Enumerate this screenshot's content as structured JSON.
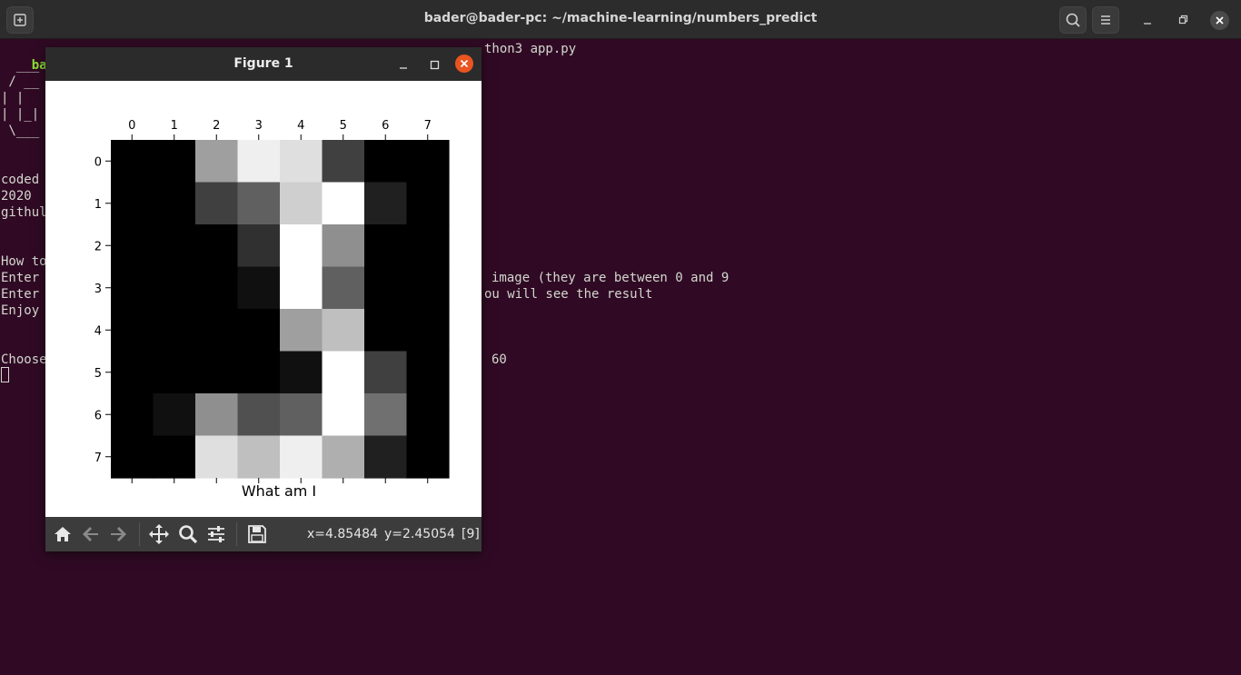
{
  "window": {
    "title": "bader@bader-pc: ~/machine-learning/numbers_predict"
  },
  "terminal": {
    "prompt_user": "bader@",
    "command_tail": "thon3 app.py",
    "lines": [
      "  ___",
      " / __",
      "| |",
      "| |_|",
      " \\___",
      "",
      "",
      "coded",
      "2020",
      "githul",
      "",
      "",
      "How to",
      "Enter",
      "Enter",
      "Enjoy",
      "",
      "",
      "Choose"
    ],
    "right_fragments": {
      "line13": "image (they are between 0 and 9",
      "line14": "ou will see the result",
      "line18": "60"
    }
  },
  "figure": {
    "title": "Figure 1",
    "xlabel": "What am I",
    "status": {
      "x": "x=4.85484",
      "y": "y=2.45054",
      "value": "[9]"
    }
  },
  "chart_data": {
    "type": "heatmap",
    "colormap": "gray",
    "xlabel": "What am I",
    "x_ticks": [
      0,
      1,
      2,
      3,
      4,
      5,
      6,
      7
    ],
    "y_ticks": [
      0,
      1,
      2,
      3,
      4,
      5,
      6,
      7
    ],
    "x_axis_position": "top",
    "vmin": 0,
    "vmax": 16,
    "values": [
      [
        0,
        0,
        10,
        15,
        14,
        4,
        0,
        0
      ],
      [
        0,
        0,
        4,
        6,
        13,
        16,
        2,
        0
      ],
      [
        0,
        0,
        0,
        3,
        16,
        9,
        0,
        0
      ],
      [
        0,
        0,
        0,
        1,
        16,
        6,
        0,
        0
      ],
      [
        0,
        0,
        0,
        0,
        10,
        12,
        0,
        0
      ],
      [
        0,
        0,
        0,
        0,
        1,
        16,
        4,
        0
      ],
      [
        0,
        1,
        9,
        5,
        6,
        16,
        7,
        0
      ],
      [
        0,
        0,
        14,
        12,
        15,
        11,
        2,
        0
      ]
    ]
  }
}
